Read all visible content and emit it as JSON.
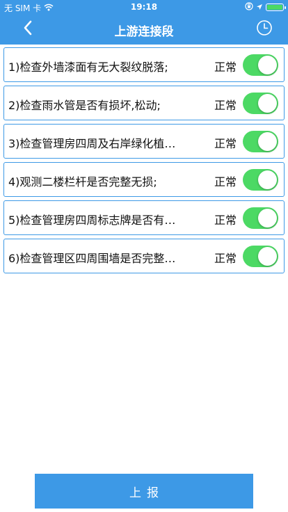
{
  "status_bar": {
    "carrier": "无 SIM 卡",
    "time": "19:18"
  },
  "nav": {
    "title": "上游连接段",
    "back_icon": "chevron-left-icon",
    "history_icon": "clock-icon"
  },
  "colors": {
    "accent": "#3d99e6",
    "toggle_on": "#4cd964"
  },
  "items": [
    {
      "text": "1)检查外墙漆面有无大裂纹脱落;",
      "status": "正常",
      "toggle_on": true
    },
    {
      "text": "2)检查雨水管是否有损坏,松动;",
      "status": "正常",
      "toggle_on": true
    },
    {
      "text": "3)检查管理房四周及右岸绿化植…",
      "status": "正常",
      "toggle_on": true
    },
    {
      "text": "4)观测二楼栏杆是否完整无损;",
      "status": "正常",
      "toggle_on": true
    },
    {
      "text": "5)检查管理房四周标志牌是否有…",
      "status": "正常",
      "toggle_on": true
    },
    {
      "text": "6)检查管理区四周围墙是否完整…",
      "status": "正常",
      "toggle_on": true
    }
  ],
  "submit_label": "上报"
}
